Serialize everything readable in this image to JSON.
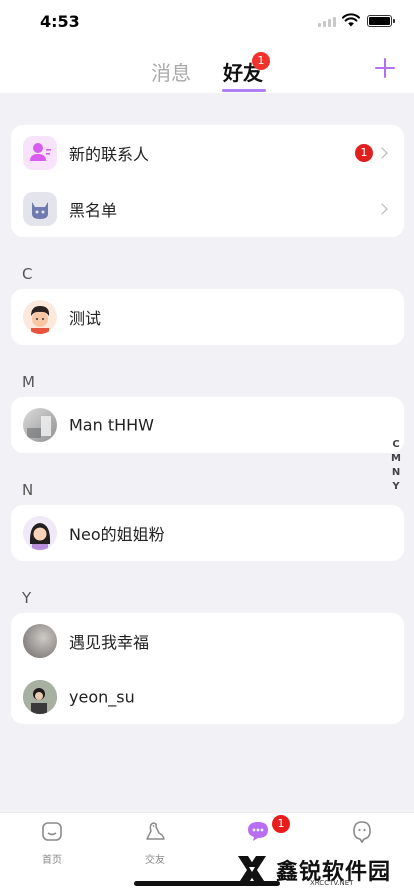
{
  "status_bar": {
    "time": "4:53"
  },
  "header": {
    "tabs": [
      {
        "label": "消息",
        "active": false
      },
      {
        "label": "好友",
        "active": true,
        "badge": "1"
      }
    ],
    "accent": "#b07ff2"
  },
  "top_card": {
    "items": [
      {
        "label": "新的联系人",
        "badge": "1",
        "icon": "new-contact-icon"
      },
      {
        "label": "黑名单",
        "icon": "blacklist-cat-icon"
      }
    ]
  },
  "sections": [
    {
      "letter": "C",
      "contacts": [
        {
          "name": "测试"
        }
      ]
    },
    {
      "letter": "M",
      "contacts": [
        {
          "name": "Man tHHW"
        }
      ]
    },
    {
      "letter": "N",
      "contacts": [
        {
          "name": "Neo的姐姐粉"
        }
      ]
    },
    {
      "letter": "Y",
      "contacts": [
        {
          "name": "遇见我幸福"
        },
        {
          "name": "yeon_su"
        }
      ]
    }
  ],
  "index_bar": [
    "C",
    "M",
    "N",
    "Y"
  ],
  "bottom_nav": {
    "items": [
      {
        "label": "首页",
        "icon": "home-icon"
      },
      {
        "label": "交友",
        "icon": "dinosaur-icon"
      },
      {
        "label": "",
        "icon": "chat-bubble-icon",
        "badge": "1"
      },
      {
        "label": "",
        "icon": "profile-icon"
      }
    ]
  },
  "watermark": {
    "text": "鑫锐软件园",
    "sub": "XRCCTV.NET"
  }
}
